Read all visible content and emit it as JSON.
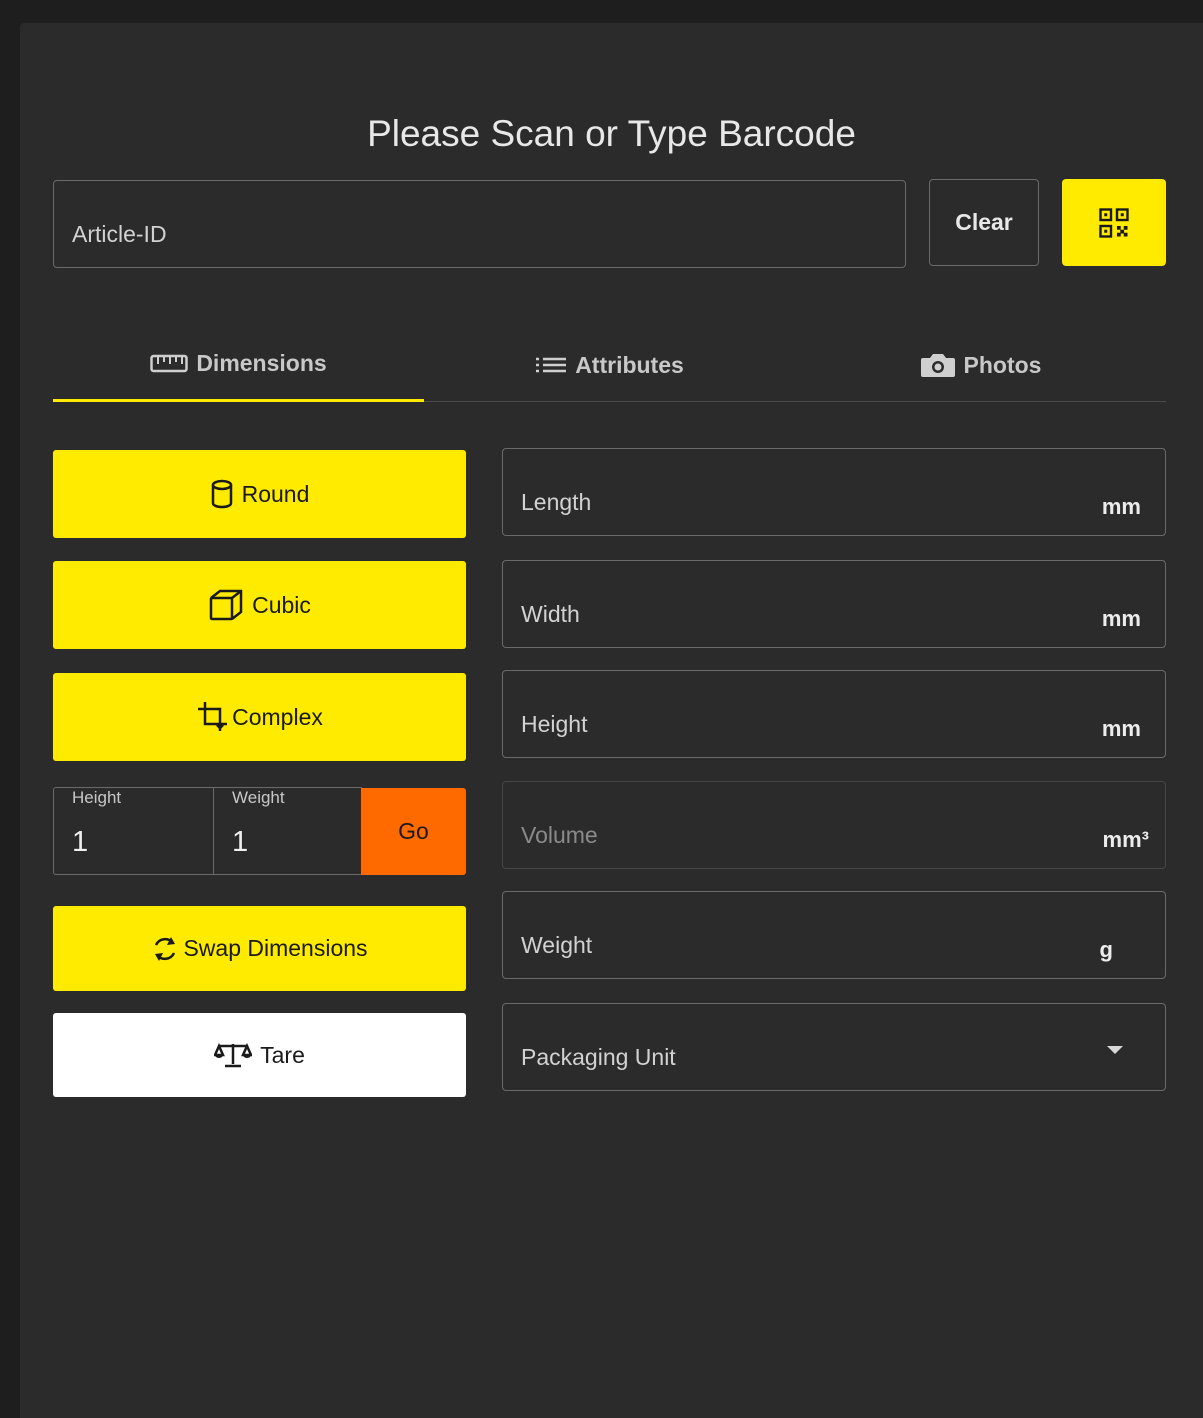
{
  "title": "Please Scan or Type Barcode",
  "search": {
    "placeholder": "Article-ID",
    "value": ""
  },
  "buttons": {
    "clear": "Clear"
  },
  "tabs": [
    {
      "label": "Dimensions",
      "icon": "ruler-icon",
      "active": true
    },
    {
      "label": "Attributes",
      "icon": "list-icon",
      "active": false
    },
    {
      "label": "Photos",
      "icon": "camera-icon",
      "active": false
    }
  ],
  "actions": {
    "round": "Round",
    "cubic": "Cubic",
    "complex": "Complex",
    "swap": "Swap Dimensions",
    "tare": "Tare",
    "go": "Go"
  },
  "mini_inputs": {
    "height": {
      "label": "Height",
      "value": "1"
    },
    "weight": {
      "label": "Weight",
      "value": "1"
    }
  },
  "fields": {
    "length": {
      "label": "Length",
      "unit": "mm"
    },
    "width": {
      "label": "Width",
      "unit": "mm"
    },
    "height": {
      "label": "Height",
      "unit": "mm"
    },
    "volume": {
      "label": "Volume",
      "unit": "mm³"
    },
    "weight": {
      "label": "Weight",
      "unit": "g"
    },
    "packaging": {
      "label": "Packaging Unit"
    }
  },
  "colors": {
    "accent": "#ffeb00",
    "go": "#ff6a00",
    "panel": "#2b2b2b",
    "background": "#1e1e1e"
  }
}
